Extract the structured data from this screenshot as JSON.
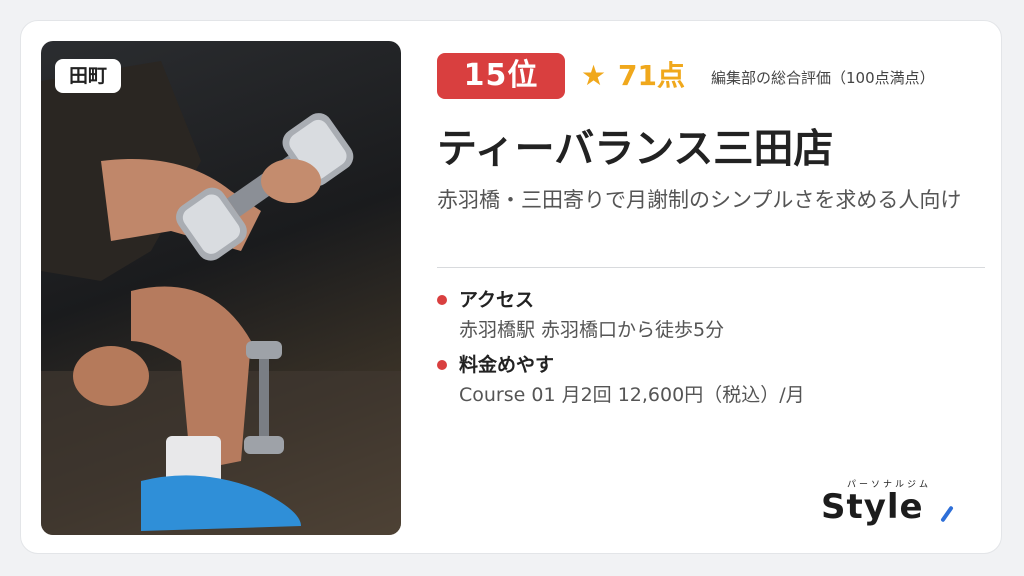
{
  "photo": {
    "area_badge": "田町",
    "icon": "dumbbell-photo-icon"
  },
  "rank": {
    "label": "15位"
  },
  "rating": {
    "star": "★",
    "score": "71点",
    "note": "編集部の総合評価（100点満点）"
  },
  "gym": {
    "name": "ティーバランス三田店",
    "catch": "赤羽橋・三田寄りで月謝制のシンプルさを求める人向け"
  },
  "info": [
    {
      "label": "アクセス",
      "value": "赤羽橋駅 赤羽橋口から徒歩5分"
    },
    {
      "label": "料金めやす",
      "value": "Course 01 月2回 12,600円（税込）/月"
    }
  ],
  "logo": {
    "kana": "パーソナルジム",
    "word": "Style"
  },
  "colors": {
    "accent_red": "#d93f3f",
    "star_gold": "#f0a81c",
    "logo_blue": "#2e6fd8"
  }
}
